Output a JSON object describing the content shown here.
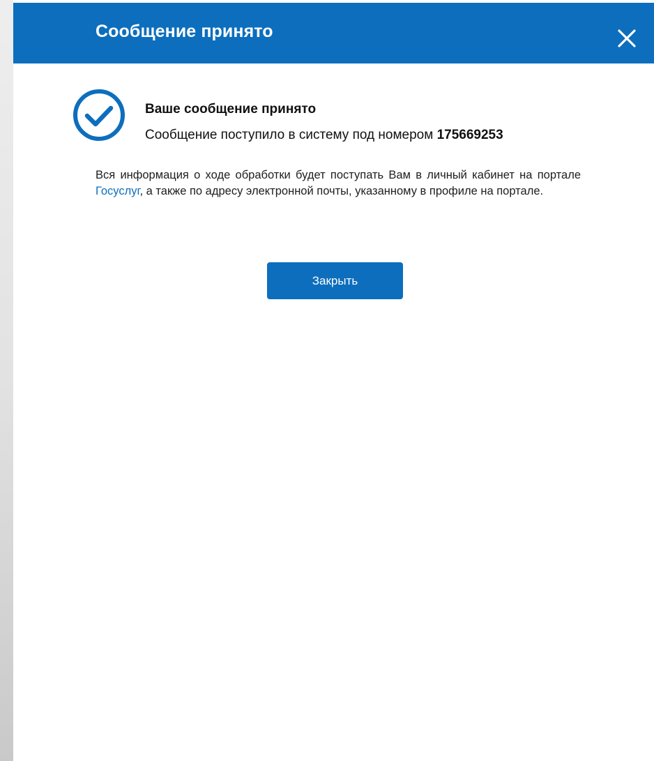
{
  "dialog": {
    "title": "Сообщение принято",
    "close_icon": "close-icon"
  },
  "status": {
    "icon": "check-circle-icon",
    "heading": "Ваше сообщение принято",
    "message_prefix": "Сообщение поступило в систему под номером",
    "message_number": "175669253"
  },
  "info": {
    "text_before_link": "Вся информация о ходе обработки будет поступать Вам в личный кабинет на портале ",
    "link_text": "Госуслуг",
    "text_after_link": ", а также по адресу электронной почты, указанному в профиле на портале."
  },
  "actions": {
    "close_label": "Закрыть"
  },
  "colors": {
    "brand_blue": "#0d6ebd",
    "text": "#111111",
    "background": "#ffffff"
  }
}
